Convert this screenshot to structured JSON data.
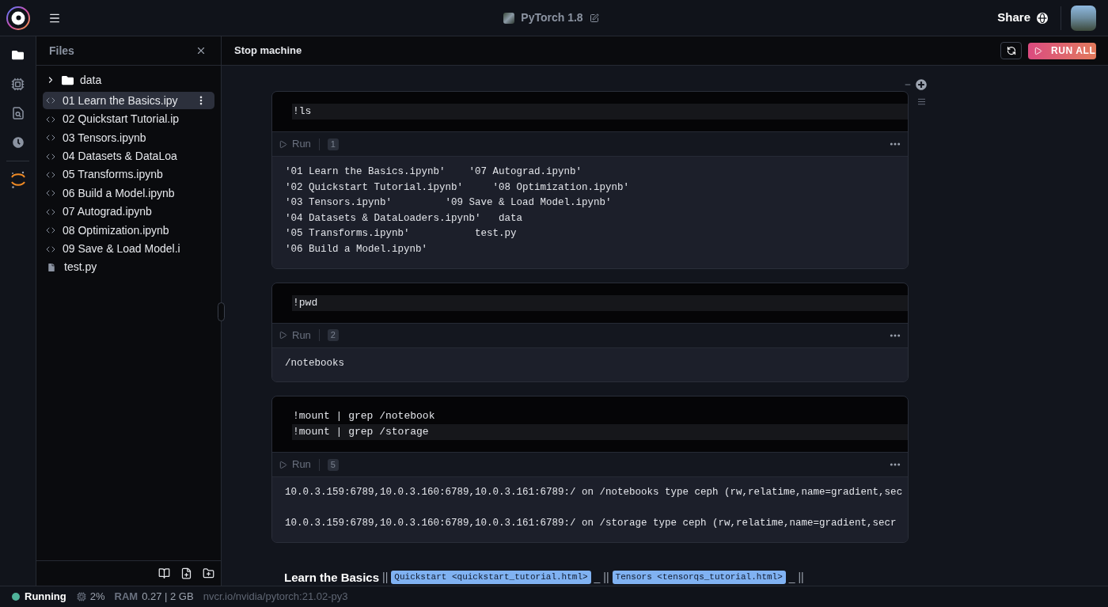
{
  "top_bar": {
    "title": "PyTorch 1.8",
    "share": "Share"
  },
  "activity_bar": [
    {
      "kind": "files",
      "selected": true
    },
    {
      "kind": "cpu",
      "selected": false
    },
    {
      "kind": "file-search",
      "selected": false
    },
    {
      "kind": "history",
      "selected": false
    }
  ],
  "files_panel": {
    "title": "Files",
    "items": [
      {
        "kind": "folder",
        "name": "data",
        "expanded": false,
        "selected": false
      },
      {
        "kind": "notebook",
        "name": "01 Learn the Basics.ipy",
        "selected": true
      },
      {
        "kind": "notebook",
        "name": "02 Quickstart Tutorial.ip",
        "selected": false
      },
      {
        "kind": "notebook",
        "name": "03 Tensors.ipynb",
        "selected": false
      },
      {
        "kind": "notebook",
        "name": "04 Datasets & DataLoa",
        "selected": false
      },
      {
        "kind": "notebook",
        "name": "05 Transforms.ipynb",
        "selected": false
      },
      {
        "kind": "notebook",
        "name": "06 Build a Model.ipynb",
        "selected": false
      },
      {
        "kind": "notebook",
        "name": "07 Autograd.ipynb",
        "selected": false
      },
      {
        "kind": "notebook",
        "name": "08 Optimization.ipynb",
        "selected": false
      },
      {
        "kind": "notebook",
        "name": "09 Save & Load Model.i",
        "selected": false
      },
      {
        "kind": "file",
        "name": "test.py",
        "selected": false
      }
    ]
  },
  "toolbar": {
    "stop": "Stop machine",
    "run_all": "RUN ALL"
  },
  "cells": [
    {
      "selected": true,
      "code": [
        {
          "text": "!ls",
          "active": true
        }
      ],
      "run": "Run",
      "count": "1",
      "output": [
        {
          "kind": "line",
          "text": "'01 Learn the Basics.ipynb'    '07 Autograd.ipynb'"
        },
        {
          "kind": "line",
          "text": "'02 Quickstart Tutorial.ipynb'     '08 Optimization.ipynb'"
        },
        {
          "kind": "line",
          "text": "'03 Tensors.ipynb'         '09 Save & Load Model.ipynb'"
        },
        {
          "kind": "line",
          "text": "'04 Datasets & DataLoaders.ipynb'   data"
        },
        {
          "kind": "line",
          "text": "'05 Transforms.ipynb'           test.py"
        },
        {
          "kind": "line",
          "text": "'06 Build a Model.ipynb'"
        }
      ]
    },
    {
      "selected": false,
      "code": [
        {
          "text": "!pwd",
          "active": true
        }
      ],
      "run": "Run",
      "count": "2",
      "output": [
        {
          "kind": "line",
          "text": "/notebooks"
        }
      ]
    },
    {
      "selected": false,
      "code": [
        {
          "text": "!mount | grep /notebook",
          "active": false
        },
        {
          "text": "!mount | grep /storage",
          "active": true
        }
      ],
      "run": "Run",
      "count": "5",
      "output": [
        {
          "kind": "line",
          "text": "10.0.3.159:6789,10.0.3.160:6789,10.0.3.161:6789:/ on /notebooks type ceph (rw,relatime,name=gradient,sec"
        },
        {
          "kind": "blank"
        },
        {
          "kind": "line",
          "text": "10.0.3.159:6789,10.0.3.160:6789,10.0.3.161:6789:/ on /storage type ceph (rw,relatime,name=gradient,secr"
        }
      ]
    }
  ],
  "markdown": [
    {
      "kind": "strong",
      "text": "Learn the Basics"
    },
    {
      "kind": "text",
      "text": "||"
    },
    {
      "kind": "code",
      "text": "Quickstart <quickstart_tutorial.html>"
    },
    {
      "kind": "text",
      "text": "_ ||"
    },
    {
      "kind": "code",
      "text": "Tensors <tensorqs_tutorial.html>"
    },
    {
      "kind": "text",
      "text": "_ ||"
    }
  ],
  "status_bar": {
    "state": "Running",
    "cpu": "2%",
    "ram_label": "RAM",
    "ram": "0.27 | 2 GB",
    "image": "nvcr.io/nvidia/pytorch:21.02-py3"
  }
}
